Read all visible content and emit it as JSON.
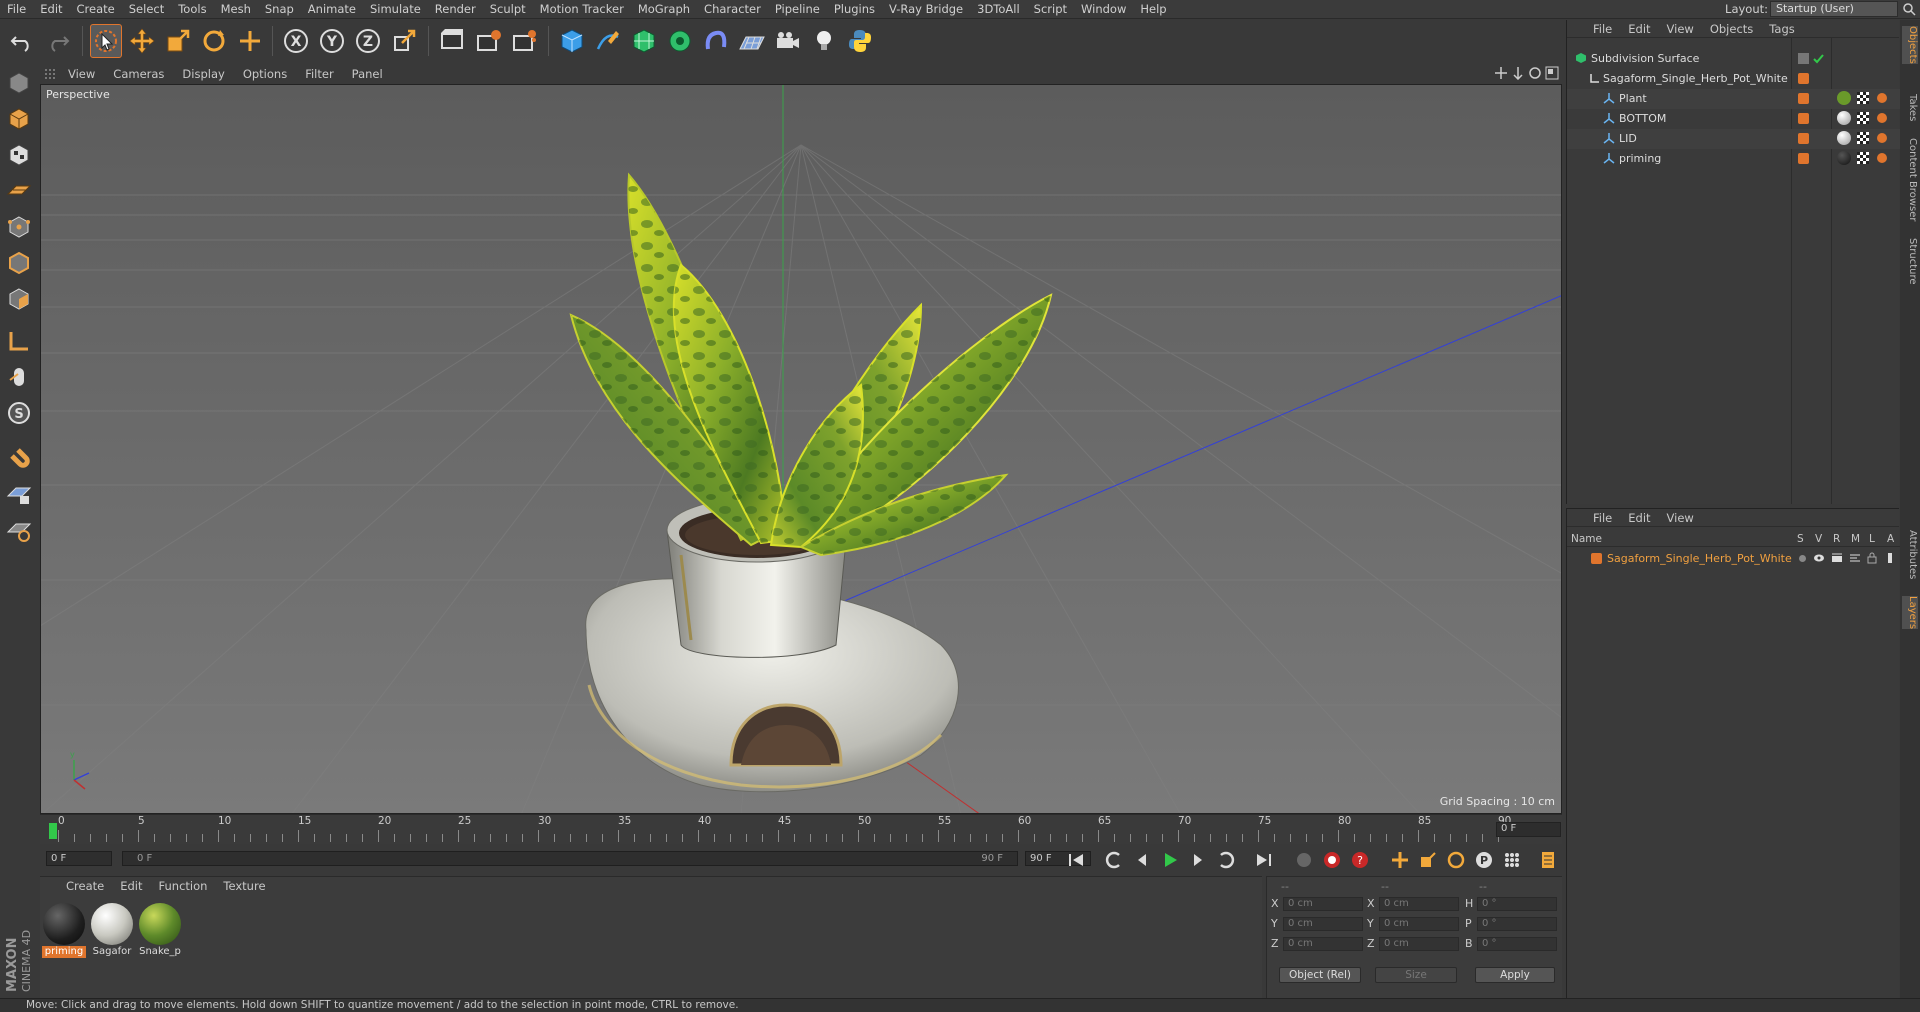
{
  "menubar": {
    "items": [
      "File",
      "Edit",
      "Create",
      "Select",
      "Tools",
      "Mesh",
      "Snap",
      "Animate",
      "Simulate",
      "Render",
      "Sculpt",
      "Motion Tracker",
      "MoGraph",
      "Character",
      "Pipeline",
      "Plugins",
      "V-Ray Bridge",
      "3DToAll",
      "Script",
      "Window",
      "Help"
    ],
    "layout_label": "Layout:",
    "layout_value": "Startup (User)"
  },
  "viewport": {
    "menu": [
      "View",
      "Cameras",
      "Display",
      "Options",
      "Filter",
      "Panel"
    ],
    "camera_label": "Perspective",
    "grid_spacing": "Grid Spacing : 10 cm"
  },
  "timeline": {
    "ticks": [
      "0",
      "5",
      "10",
      "15",
      "20",
      "25",
      "30",
      "35",
      "40",
      "45",
      "50",
      "55",
      "60",
      "65",
      "70",
      "75",
      "80",
      "85",
      "90"
    ],
    "current_frame": "0 F",
    "start_field": "0 F",
    "range_start": "0 F",
    "range_end": "90 F",
    "end_field": "90 F"
  },
  "material_manager": {
    "menu": [
      "Create",
      "Edit",
      "Function",
      "Texture"
    ],
    "materials": [
      {
        "name": "priming",
        "selected": true
      },
      {
        "name": "Sagafor",
        "selected": false
      },
      {
        "name": "Snake_p",
        "selected": false
      }
    ]
  },
  "coordinates": {
    "header": [
      "--",
      "--",
      "--"
    ],
    "rows": [
      {
        "l1": "X",
        "v1": "0 cm",
        "l2": "X",
        "v2": "0 cm",
        "l3": "H",
        "v3": "0 °"
      },
      {
        "l1": "Y",
        "v1": "0 cm",
        "l2": "Y",
        "v2": "0 cm",
        "l3": "P",
        "v3": "0 °"
      },
      {
        "l1": "Z",
        "v1": "0 cm",
        "l2": "Z",
        "v2": "0 cm",
        "l3": "B",
        "v3": "0 °"
      }
    ],
    "mode_select": "Object (Rel)",
    "size_select": "Size",
    "apply_label": "Apply"
  },
  "brand": {
    "line1": "MAXON",
    "line2": "CINEMA 4D"
  },
  "status": "Move: Click and drag to move elements. Hold down SHIFT to quantize movement / add to the selection in point mode, CTRL to remove.",
  "object_manager": {
    "menu": [
      "File",
      "Edit",
      "View",
      "Objects",
      "Tags"
    ],
    "objects": [
      {
        "name": "Subdivision Surface",
        "depth": 0
      },
      {
        "name": "Sagaform_Single_Herb_Pot_White",
        "depth": 1
      },
      {
        "name": "Plant",
        "depth": 2
      },
      {
        "name": "BOTTOM",
        "depth": 2
      },
      {
        "name": "LID",
        "depth": 2
      },
      {
        "name": "priming",
        "depth": 2
      }
    ]
  },
  "layer_manager": {
    "menu": [
      "File",
      "Edit",
      "View"
    ],
    "columns": {
      "name": "Name",
      "flags": [
        "S",
        "V",
        "R",
        "M",
        "L",
        "A"
      ]
    },
    "layers": [
      {
        "name": "Sagaform_Single_Herb_Pot_White",
        "color": "#e0752d"
      }
    ]
  },
  "side_tabs": [
    "Objects",
    "Takes",
    "Content Browser",
    "Structure",
    "Attributes",
    "Layers"
  ],
  "colors": {
    "accent": "#e0752d",
    "active_frame": "#32c84a",
    "viewport_bg": "#6a6a6a"
  }
}
